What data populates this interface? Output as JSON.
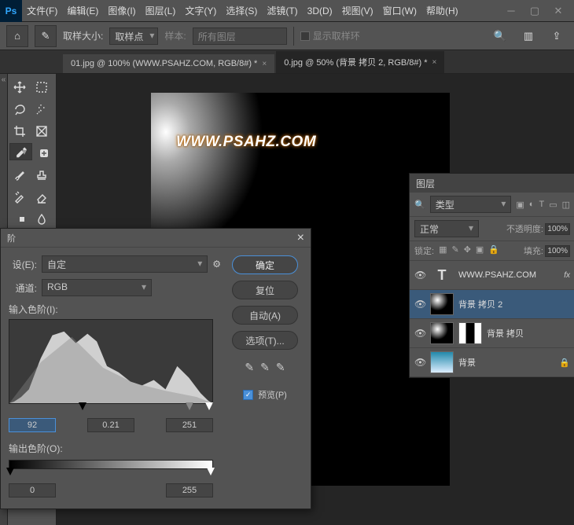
{
  "menu": {
    "file": "文件(F)",
    "edit": "编辑(E)",
    "image": "图像(I)",
    "layer": "图层(L)",
    "type": "文字(Y)",
    "select": "选择(S)",
    "filter": "滤镜(T)",
    "threeD": "3D(D)",
    "view": "视图(V)",
    "window": "窗口(W)",
    "help": "帮助(H)"
  },
  "optbar": {
    "sampleSizeLabel": "取样大小:",
    "sampleSizeValue": "取样点",
    "sampleLabel": "样本:",
    "sampleValue": "所有图层",
    "showRing": "显示取样环"
  },
  "tabs": {
    "t1": "01.jpg @ 100% (WWW.PSAHZ.COM, RGB/8#) *",
    "t2": "0.jpg @ 50% (背景 拷贝 2, RGB/8#) *"
  },
  "watermark": "WWW.PSAHZ.COM",
  "levels": {
    "title": "阶",
    "presetLabel": "设(E):",
    "presetValue": "自定",
    "channelLabel": "通道:",
    "channelValue": "RGB",
    "inputLabel": "输入色阶(I):",
    "inBlack": "92",
    "inGamma": "0.21",
    "inWhite": "251",
    "outputLabel": "输出色阶(O):",
    "outBlack": "0",
    "outWhite": "255",
    "ok": "确定",
    "reset": "复位",
    "auto": "自动(A)",
    "options": "选项(T)...",
    "preview": "预览(P)"
  },
  "layers": {
    "title": "图层",
    "kind": "类型",
    "blend": "正常",
    "opacityLabel": "不透明度:",
    "opacityValue": "100%",
    "lockLabel": "锁定:",
    "fillLabel": "填充:",
    "fillValue": "100%",
    "l1": "WWW.PSAHZ.COM",
    "l2": "背景 拷贝 2",
    "l3": "背景 拷贝",
    "l4": "背景"
  }
}
